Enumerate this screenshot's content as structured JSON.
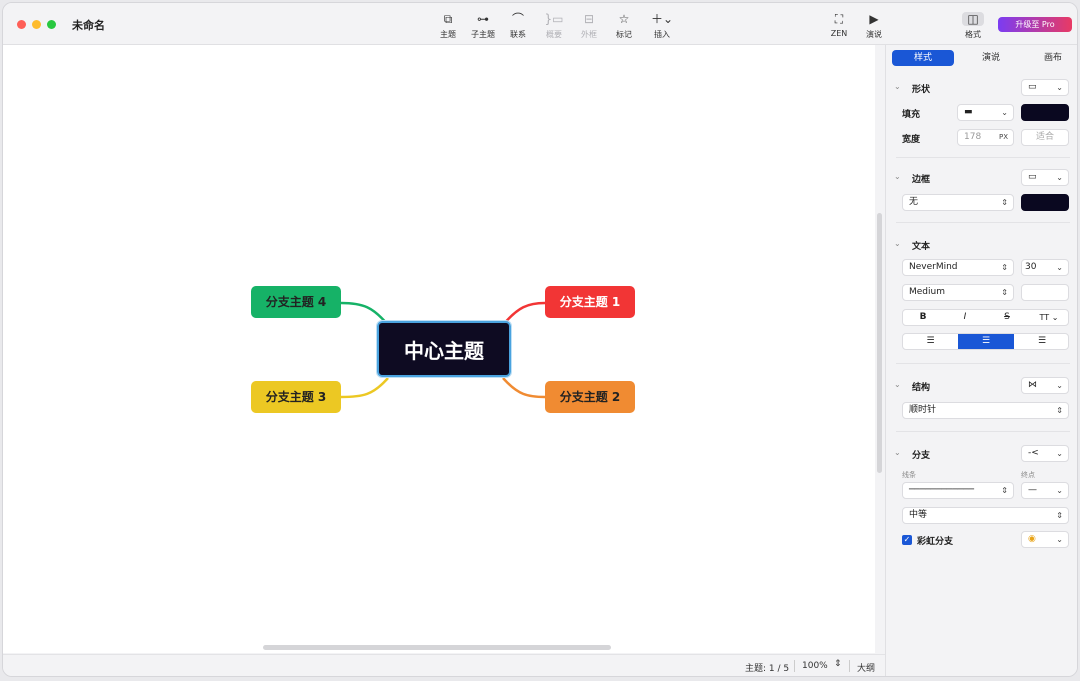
{
  "window": {
    "title": "未命名"
  },
  "toolbar": {
    "topic": "主题",
    "subtopic": "子主题",
    "relationship": "联系",
    "summary": "概要",
    "boundary": "外框",
    "marker": "标记",
    "insert": "插入",
    "zen": "ZEN",
    "present": "演说",
    "format": "格式",
    "upgrade": "升级至 Pro"
  },
  "mindmap": {
    "central": "中心主题",
    "branches": [
      "分支主题 1",
      "分支主题 2",
      "分支主题 3",
      "分支主题 4"
    ],
    "colors": {
      "b1": "#f23535",
      "b2": "#f08b32",
      "b3": "#ecc823",
      "b4": "#16b267",
      "central": "#0e0b22"
    }
  },
  "status": {
    "topics": "主题: 1 / 5",
    "zoom": "100%",
    "outline": "大纲"
  },
  "panel": {
    "tabs": [
      "样式",
      "演说",
      "画布"
    ],
    "shape": {
      "title": "形状",
      "fill_label": "填充",
      "width_label": "宽度",
      "width_value": "178",
      "width_unit": "PX",
      "fit_label": "适合"
    },
    "border": {
      "title": "边框",
      "style_value": "无"
    },
    "text": {
      "title": "文本",
      "font_value": "NeverMind",
      "size_value": "30",
      "weight_value": "Medium",
      "bold": "B",
      "italic": "I",
      "strike": "S",
      "case": "TT"
    },
    "structure": {
      "title": "结构",
      "value": "顺时针"
    },
    "branch": {
      "title": "分支",
      "line_label": "线条",
      "end_label": "终点",
      "thickness_value": "中等",
      "rainbow_label": "彩虹分支"
    }
  }
}
